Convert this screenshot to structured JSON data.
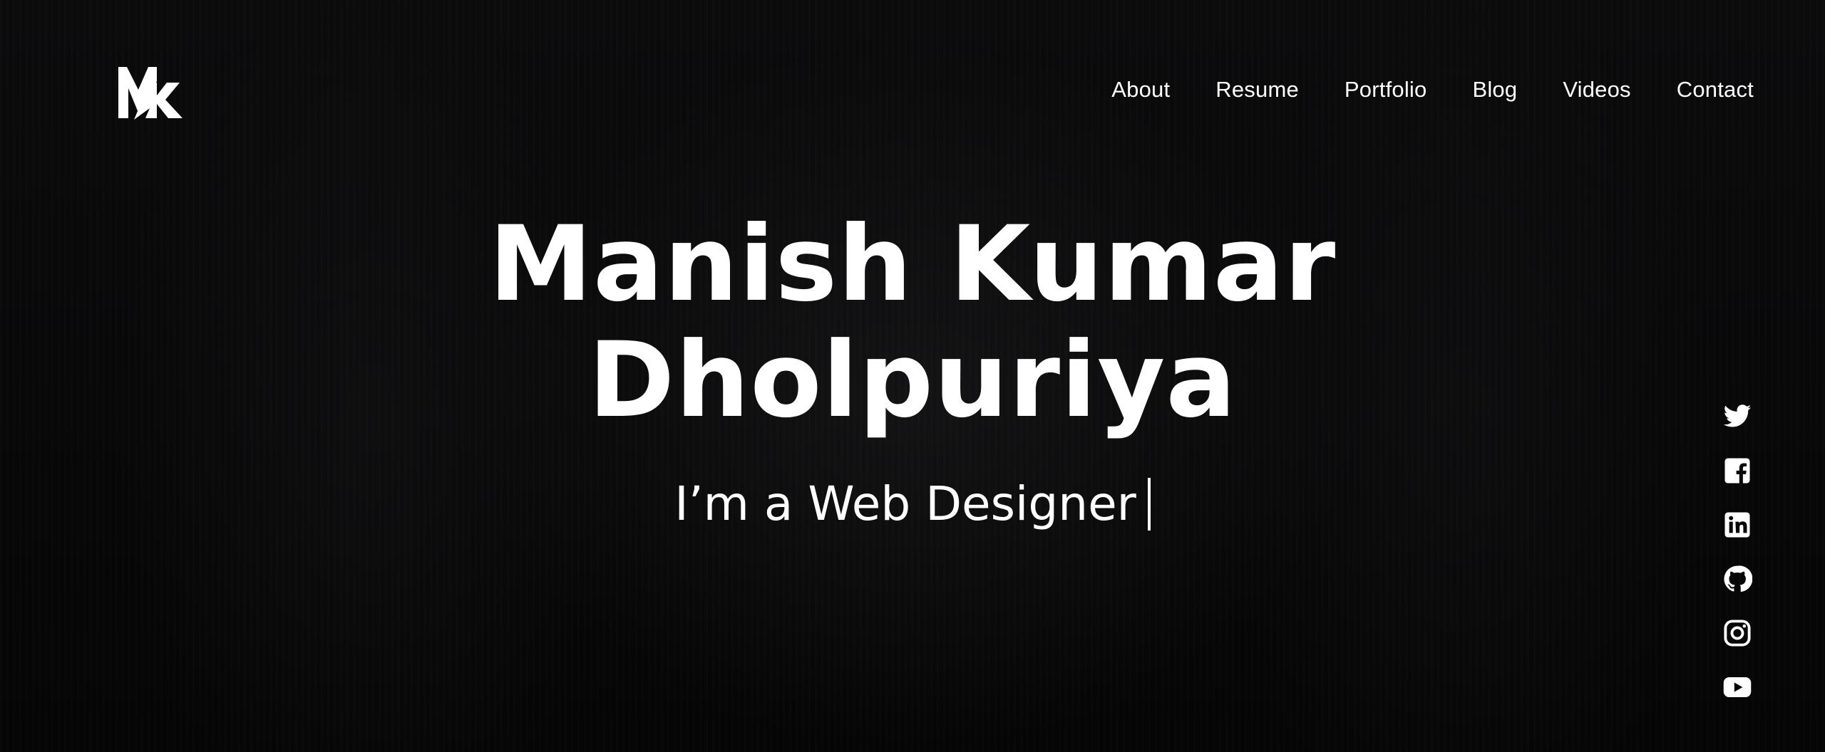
{
  "brand": {
    "logo_icon": "mk-logo-icon"
  },
  "nav": {
    "items": [
      {
        "label": "About"
      },
      {
        "label": "Resume"
      },
      {
        "label": "Portfolio"
      },
      {
        "label": "Blog"
      },
      {
        "label": "Videos"
      },
      {
        "label": "Contact"
      }
    ]
  },
  "hero": {
    "name_line1": "Manish Kumar",
    "name_line2": "Dholpuriya",
    "typed_text": "I’m a Web Designer"
  },
  "social": [
    {
      "icon": "twitter-icon"
    },
    {
      "icon": "facebook-icon"
    },
    {
      "icon": "linkedin-icon"
    },
    {
      "icon": "github-icon"
    },
    {
      "icon": "instagram-icon"
    },
    {
      "icon": "youtube-icon"
    }
  ],
  "colors": {
    "background": "#060606",
    "text": "#ffffff"
  }
}
